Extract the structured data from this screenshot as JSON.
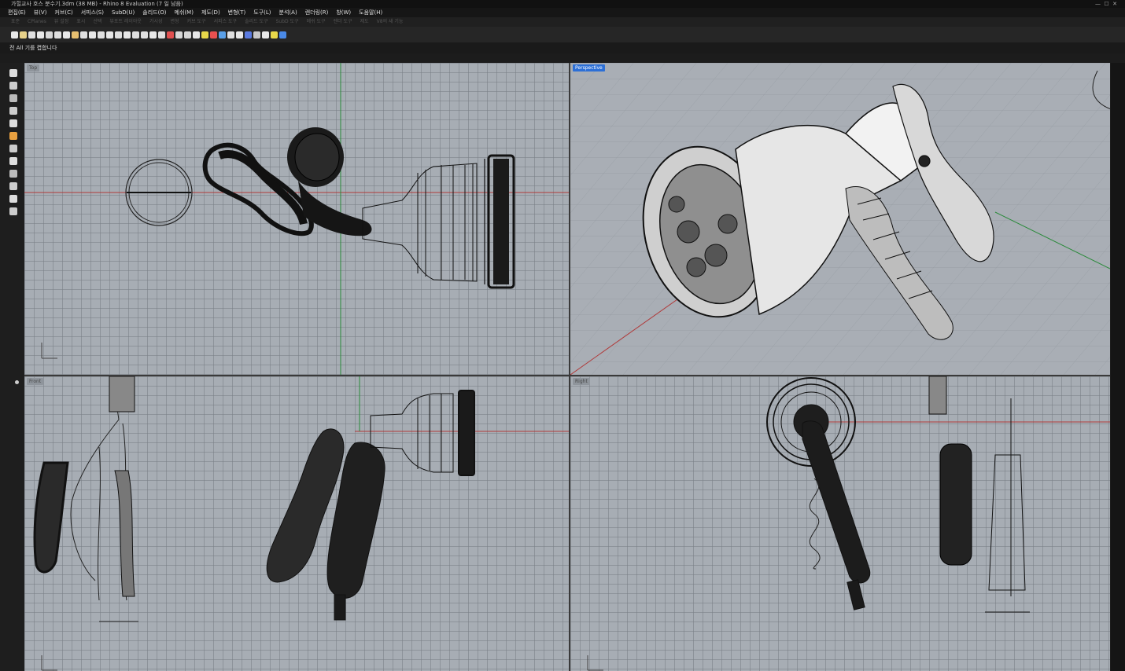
{
  "window": {
    "title": "가힐교사 호스 분수기.3dm (38 MB) - Rhino 8 Evaluation (7 일 남음)"
  },
  "menu": {
    "items": [
      "편집(E)",
      "뷰(V)",
      "커브(C)",
      "서피스(S)",
      "SubD(U)",
      "솔리드(O)",
      "메쉬(M)",
      "제도(D)",
      "변형(T)",
      "도구(L)",
      "분석(A)",
      "렌더링(R)",
      "창(W)",
      "도움말(H)"
    ]
  },
  "tabstrip": {
    "items": [
      "표준",
      "CPlanes",
      "뷰 설정",
      "표시",
      "선택",
      "뷰포트 레이아웃",
      "가시성",
      "변형",
      "커브 도구",
      "서피스 도구",
      "솔리드 도구",
      "SubD 도구",
      "메쉬 도구",
      "렌더 도구",
      "제도",
      "V8의 새 기능"
    ]
  },
  "toolbar": {
    "icon_names": [
      "new-icon",
      "open-icon",
      "save-icon",
      "print-icon",
      "import-icon",
      "cut-icon",
      "copy-icon",
      "paste-icon",
      "undo-icon",
      "pan-icon",
      "rotate-icon",
      "zoom-icon",
      "zoom-window-icon",
      "zoom-extents-icon",
      "zoom-selected-icon",
      "rotate-view-icon",
      "viewport-layout-icon",
      "select-icon",
      "cplane-icon",
      "osnap-icon",
      "layer-icon",
      "properties-icon",
      "light-icon",
      "color-icon",
      "material-icon",
      "render-icon",
      "display-mode-icon",
      "texture-icon",
      "environment-icon",
      "options-icon",
      "help-icon",
      "globe-icon"
    ],
    "icon_colors": [
      "#e8e8e8",
      "#e8d28a",
      "#e0e0e0",
      "#e8e8e8",
      "#d8d8d8",
      "#e0e0e0",
      "#e8e8e8",
      "#e8c070",
      "#e0e0e0",
      "#e8e8e8",
      "#e0e0e0",
      "#e8e8e8",
      "#e0e0e0",
      "#e8e8e8",
      "#e0e0e0",
      "#e0e0e0",
      "#e8e8e8",
      "#e0e0e0",
      "#e05050",
      "#d8d8d8",
      "#d8d8d8",
      "#e8e8e8",
      "#e8d84a",
      "#e85050",
      "#5aa0e8",
      "#e0e0e0",
      "#e8e8e8",
      "#5a7ae0",
      "#c8c8c8",
      "#e8e8e8",
      "#e8d84a",
      "#4a8ae8"
    ]
  },
  "command": {
    "prompt": "전 All 기를 켭합니다"
  },
  "viewports": {
    "top": {
      "label": "Top"
    },
    "perspective": {
      "label": "Perspective"
    },
    "front": {
      "label": "Front"
    },
    "right": {
      "label": "Right"
    }
  },
  "colors": {
    "viewport_bg": "#a7adb4",
    "active_label": "#2c6fd6",
    "x_axis": "#b03a3a",
    "y_axis": "#2a8a3a",
    "wire": "#111111"
  }
}
